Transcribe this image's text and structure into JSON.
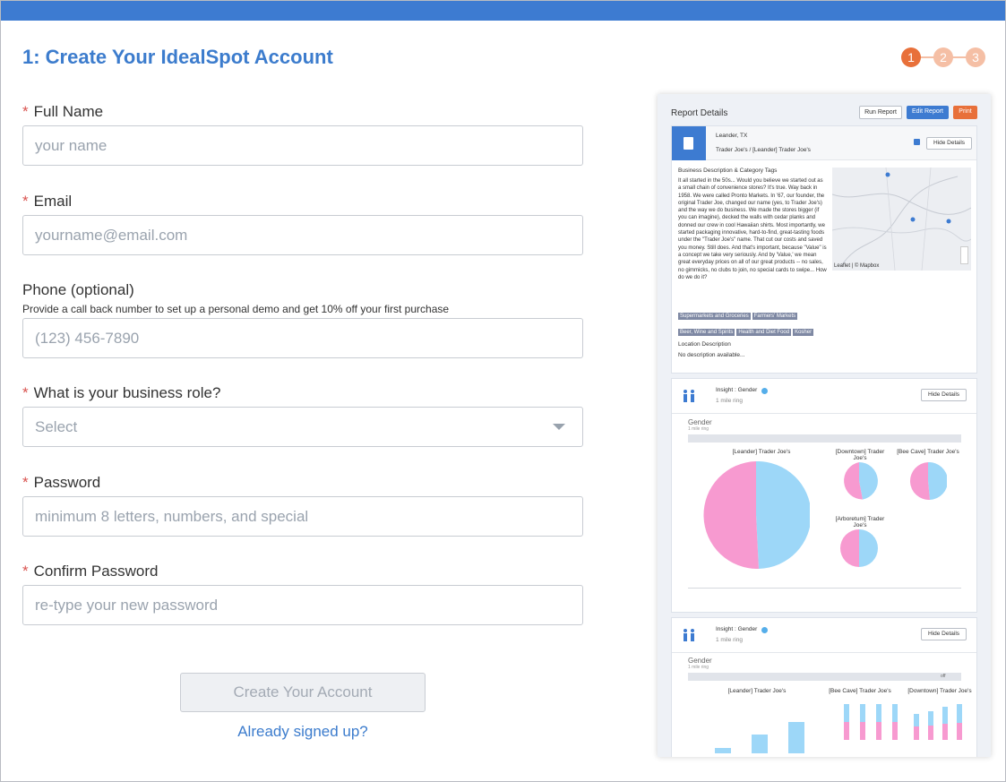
{
  "header": {
    "title": "1: Create Your IdealSpot Account",
    "steps": [
      "1",
      "2",
      "3"
    ]
  },
  "form": {
    "full_name": {
      "label": "Full Name",
      "placeholder": "your name"
    },
    "email": {
      "label": "Email",
      "placeholder": "yourname@email.com"
    },
    "phone": {
      "label": "Phone (optional)",
      "help": "Provide a call back number to set up a personal demo and get 10% off your first purchase",
      "placeholder": "(123) 456-7890"
    },
    "role": {
      "label": "What is your business role?",
      "selected": "Select"
    },
    "password": {
      "label": "Password",
      "placeholder": "minimum 8 letters, numbers, and special"
    },
    "confirm_password": {
      "label": "Confirm Password",
      "placeholder": "re-type your new password"
    },
    "submit_label": "Create Your Account",
    "signin_link": "Already signed up?"
  },
  "preview": {
    "title": "Report Details",
    "buttons": {
      "run": "Run Report",
      "edit": "Edit Report",
      "print": "Print"
    },
    "location": {
      "city": "Leander, TX",
      "store": "Trader Joe's / [Leander] Trader Joe's",
      "hide_label": "Hide Details",
      "desc_title": "Business Description & Category Tags",
      "desc_text": "It all started in the 50s... Would you believe we started out as a small chain of convenience stores? It's true. Way back in 1958. We were called Pronto Markets. In '67, our founder, the original Trader Joe, changed our name (yes, to Trader Joe's) and the way we do business. We made the stores bigger (if you can imagine), decked the walls with cedar planks and donned our crew in cool Hawaiian shirts. Most importantly, we started packaging innovative, hard-to-find, great-tasting foods under the \"Trader Joe's\" name. That cut our costs and saved you money. Still does. And that's important, because \"Value\" is a concept we take very seriously. And by 'Value,' we mean great everyday prices on all of our great products -- no sales, no gimmicks, no clubs to join, no special cards to swipe... How do we do it?",
      "tags": [
        "Supermarkets and Groceries",
        "Farmers' Markets",
        "Beer, Wine and Spirits",
        "Health and Diet Food",
        "Kosher"
      ],
      "map_credit": "Leaflet | © Mapbox",
      "loc_desc_title": "Location Description",
      "loc_desc_text": "No description available..."
    },
    "insight1": {
      "title": "Insight : Gender",
      "ring": "1 mile ring",
      "hide_label": "Hide Details",
      "chart_title": "Gender",
      "chart_sub": "1 mile ring",
      "pies": [
        {
          "label": "[Leander] Trader Joe's"
        },
        {
          "label": "[Downtown] Trader Joe's"
        },
        {
          "label": "[Bee Cave] Trader Joe's"
        },
        {
          "label": "[Arboretum] Trader Joe's"
        }
      ]
    },
    "insight2": {
      "title": "Insight : Gender",
      "ring": "1 mile ring",
      "hide_label": "Hide Details",
      "chart_title": "Gender",
      "chart_sub": "1 mile ring",
      "toggle": "off",
      "groups": [
        "[Leander] Trader Joe's",
        "[Bee Cave] Trader Joe's",
        "[Downtown] Trader Joe's"
      ]
    }
  },
  "colors": {
    "brand_blue": "#3c7ccd",
    "topbar": "#3d7bd1",
    "step_active": "#e8703a",
    "step_inactive": "#f5bfa5",
    "pie_female": "#f79ad0",
    "pie_male": "#9dd7f8"
  }
}
